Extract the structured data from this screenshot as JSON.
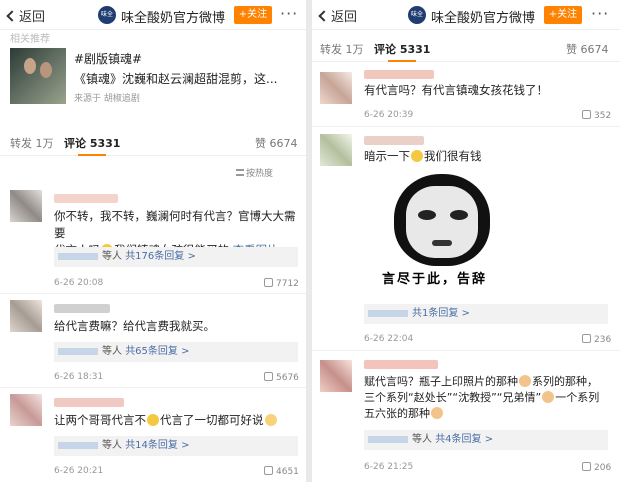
{
  "header": {
    "back_label": "返回",
    "account_name": "味全酸奶官方微博",
    "avatar_text": "味全",
    "follow_label": "+关注",
    "more_label": "···"
  },
  "left": {
    "prev_text": "相关推荐",
    "card": {
      "title": "#剧版镇魂#",
      "desc": "《镇魂》沈巍和赵云澜超甜混剪，这...",
      "source": "来源于 胡椒追剧"
    },
    "tabs": {
      "repost": "转发 1万",
      "comment": "评论 5331",
      "like": "赞 6674"
    },
    "sort_label": "按热度",
    "comments": [
      {
        "text_line1": "你不转，我不转，巍澜何时有代言？官博大大需要",
        "text_line2a": "代言人吗",
        "text_line2b": "我们镇魂女孩很能买的",
        "text_line2c": "查看图片",
        "reply_summary": "等人",
        "reply_link": "共176条回复 >",
        "time": "6-26 20:08",
        "likes": "7712"
      },
      {
        "text_line1": "给代言费嘛？给代言费我就买。",
        "reply_summary": "等人",
        "reply_link": "共65条回复 >",
        "time": "6-26 18:31",
        "likes": "5676"
      },
      {
        "text_line1a": "让两个哥哥代言不",
        "text_line1b": "代言了一切都可好说",
        "reply_summary": "等人",
        "reply_link": "共14条回复 >",
        "time": "6-26 20:21",
        "likes": "4651"
      }
    ]
  },
  "right": {
    "tabs": {
      "repost": "转发 1万",
      "comment": "评论 5331",
      "like": "赞 6674"
    },
    "comments": [
      {
        "text_line1": "有代言吗？有代言镇魂女孩花钱了！",
        "time": "6-26 20:39",
        "likes": "352"
      },
      {
        "text_line1a": "暗示一下",
        "text_line1b": "我们很有钱",
        "meme_caption": "言尽于此，告辞",
        "reply_link": "共1条回复 >",
        "time": "6-26 22:04",
        "likes": "236"
      },
      {
        "text_line1a": "赋代言吗？瓶子上印照片的那种",
        "text_line1b": "系列的那种，",
        "text_line2a": "三个系列“赵处长”“沈教授”“兄弟情”",
        "text_line2b": "一个系列",
        "text_line3": "五六张的那种",
        "reply_summary": "等人",
        "reply_link": "共4条回复 >",
        "time": "6-26 21:25",
        "likes": "206"
      }
    ]
  },
  "colors": {
    "accent": "#ff8200",
    "link": "#4a6da5"
  }
}
